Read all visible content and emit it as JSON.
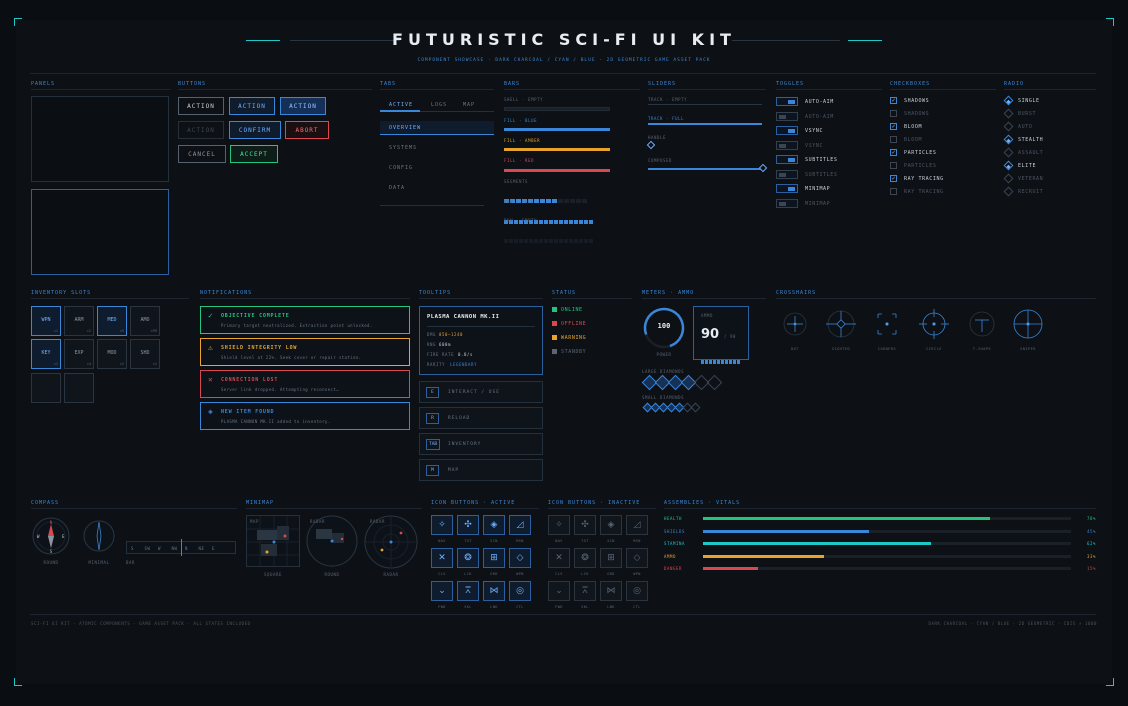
{
  "header": {
    "title": "FUTURISTIC SCI-FI UI KIT",
    "subtitle": "COMPONENT SHOWCASE · DARK CHARCOAL / CYAN / BLUE · 2D GEOMETRIC GAME ASSET PACK"
  },
  "sections": {
    "panels": "PANELS",
    "buttons": "BUTTONS",
    "tabs": "TABS",
    "bars": "BARS",
    "sliders": "SLIDERS",
    "toggles": "TOGGLES",
    "checkboxes": "CHECKBOXES",
    "radio": "RADIO",
    "inventory": "INVENTORY SLOTS",
    "notifications": "NOTIFICATIONS",
    "tooltips": "TOOLTIPS",
    "status": "STATUS",
    "meters": "METERS · AMMO",
    "crosshairs": "CROSSHAIRS",
    "compass": "COMPASS",
    "minimap": "MINIMAP",
    "icon_active": "ICON BUTTONS · ACTIVE",
    "icon_inactive": "ICON BUTTONS · INACTIVE",
    "assemblies": "ASSEMBLIES · VITALS"
  },
  "buttons": {
    "r1": [
      "ACTION",
      "ACTION",
      "ACTION"
    ],
    "r2": [
      "ACTION",
      "CONFIRM",
      "ABORT"
    ],
    "r3": [
      "CANCEL",
      "ACCEPT"
    ]
  },
  "tabs": {
    "top": [
      "ACTIVE",
      "LOGS",
      "MAP"
    ],
    "side": [
      "OVERVIEW",
      "SYSTEMS",
      "CONFIG",
      "DATA"
    ]
  },
  "bars": {
    "labels": [
      "SHELL · EMPTY",
      "FILL · BLUE",
      "FILL · AMBER",
      "FILL · RED",
      "SEGMENTS",
      "ROW · FULL",
      "ROW · EMPTY"
    ],
    "colors": {
      "blue": "#3a86d8",
      "amber": "#e8a32c",
      "red": "#d94850"
    }
  },
  "sliders": {
    "labels": [
      "TRACK · EMPTY",
      "TRACK · FULL",
      "HANDLE",
      "COMPOSED"
    ]
  },
  "toggles": [
    "AUTO-AIM",
    "AUTO-AIM",
    "VSYNC",
    "VSYNC",
    "SUBTITLES",
    "SUBTITLES",
    "MINIMAP",
    "MINIMAP"
  ],
  "checkboxes": [
    "SHADOWS",
    "SHADOWS",
    "BLOOM",
    "BLOOM",
    "PARTICLES",
    "PARTICLES",
    "RAY TRACING",
    "RAY TRACING"
  ],
  "radio": [
    "SINGLE",
    "BURST",
    "AUTO",
    "STEALTH",
    "ASSAULT",
    "ELITE",
    "VETERAN",
    "RECRUIT"
  ],
  "inventory": [
    {
      "name": "WPN",
      "count": "×1",
      "active": true
    },
    {
      "name": "ARM",
      "count": "×2",
      "active": false
    },
    {
      "name": "MED",
      "count": "×5",
      "active": true
    },
    {
      "name": "AMO",
      "count": "×99",
      "active": false
    },
    {
      "name": "KEY",
      "count": "×1",
      "active": true
    },
    {
      "name": "EXP",
      "count": "×4",
      "active": false
    },
    {
      "name": "MOD",
      "count": "×2",
      "active": false
    },
    {
      "name": "SHD",
      "count": "×1",
      "active": false
    }
  ],
  "notifications": [
    {
      "title": "OBJECTIVE COMPLETE",
      "desc": "Primary target neutralized. Extraction point unlocked.",
      "icon": "✓",
      "color": "#23c47e"
    },
    {
      "title": "SHIELD INTEGRITY LOW",
      "desc": "Shield level at 22%. Seek cover or repair station.",
      "icon": "⚠",
      "color": "#e8a32c"
    },
    {
      "title": "CONNECTION LOST",
      "desc": "Server link dropped. Attempting reconnect…",
      "icon": "✕",
      "color": "#d94850"
    },
    {
      "title": "NEW ITEM FOUND",
      "desc": "PLASMA CANNON MK.II added to inventory.",
      "icon": "◈",
      "color": "#3a86d8"
    }
  ],
  "tooltip": {
    "title": "PLASMA CANNON MK.II",
    "dmg_label": "DMG",
    "dmg": "850–1240",
    "rng_label": "RNG",
    "rng": "600m",
    "rate_label": "FIRE RATE",
    "rate": "0.8/s",
    "rarity_label": "RARITY",
    "rarity": "LEGENDARY"
  },
  "keys": [
    {
      "k": "E",
      "l": "INTERACT / USE"
    },
    {
      "k": "R",
      "l": "RELOAD"
    },
    {
      "k": "TAB",
      "l": "INVENTORY"
    },
    {
      "k": "M",
      "l": "MAP"
    }
  ],
  "status": [
    {
      "label": "ONLINE",
      "color": "#23c47e"
    },
    {
      "label": "OFFLINE",
      "color": "#d94850"
    },
    {
      "label": "WARNING",
      "color": "#e8a32c"
    },
    {
      "label": "STANDBY",
      "color": "#5a6674"
    }
  ],
  "meters": {
    "power_value": "100",
    "power_label": "POWER",
    "ammo_label": "AMMO",
    "ammo": "90",
    "ammo_max": "/ 90",
    "large": "LARGE DIAMONDS",
    "small": "SMALL DIAMONDS"
  },
  "crosshairs": [
    "DOT",
    "SIGHTED",
    "CORNERS",
    "CIRCLE",
    "T-SHAPE",
    "SNIPER"
  ],
  "compass": {
    "labels": [
      "ROUND",
      "MINIMAL",
      "BAR"
    ],
    "bar": [
      "S",
      "SW",
      "W",
      "NW",
      "N",
      "NE",
      "E"
    ]
  },
  "minimap": {
    "labels": [
      "SQUARE",
      "ROUND",
      "RADAR"
    ],
    "tags": [
      "MAP",
      "RADAR",
      "RADAR"
    ]
  },
  "icons": {
    "labels": [
      "NAV",
      "TGT",
      "SCN",
      "MSN",
      "CLS",
      "LCK",
      "GRD",
      "WPN",
      "FWD",
      "SKL",
      "LNK",
      "CTL"
    ],
    "glyphs": [
      "✧",
      "✣",
      "◈",
      "◿",
      "✕",
      "❂",
      "⊞",
      "◇",
      "⌄",
      "⩞",
      "⋈",
      "◎"
    ]
  },
  "vitals": [
    {
      "label": "HEALTH",
      "value": "78%",
      "pct": 78,
      "color": "#23c47e"
    },
    {
      "label": "SHIELDS",
      "value": "45%",
      "pct": 45,
      "color": "#3a86d8"
    },
    {
      "label": "STAMINA",
      "value": "62%",
      "pct": 62,
      "color": "#1ec8c8"
    },
    {
      "label": "AMMO",
      "value": "33%",
      "pct": 33,
      "color": "#e8a32c"
    },
    {
      "label": "DANGER",
      "value": "15%",
      "pct": 15,
      "color": "#d94850"
    }
  ],
  "footer": {
    "left": "SCI-FI UI KIT · ATOMIC COMPONENTS · GAME ASSET PACK · ALL STATES INCLUDED",
    "right": "DARK CHARCOAL · CYAN / BLUE · 2D GEOMETRIC · CDIS × 1000"
  }
}
